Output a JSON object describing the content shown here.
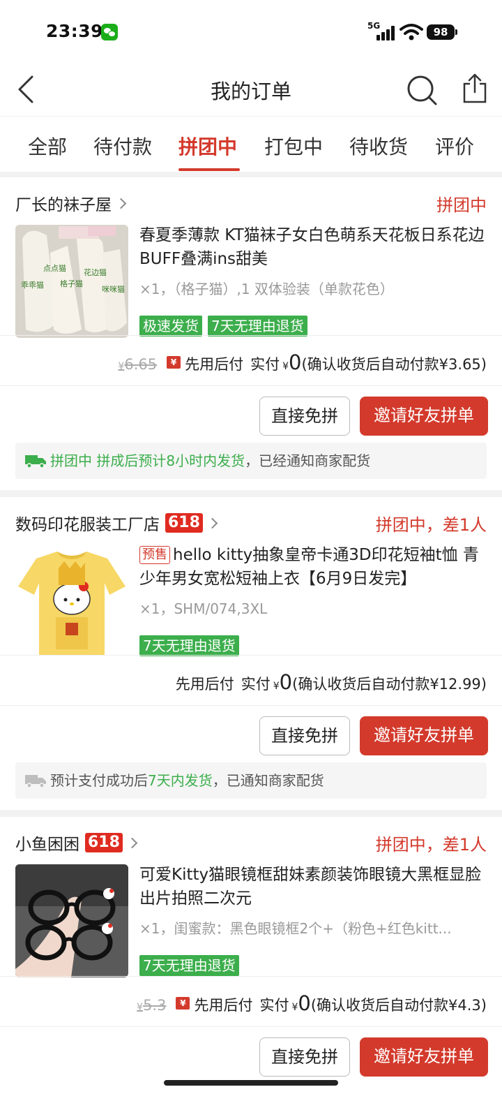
{
  "status_bar": {
    "time": "23:39",
    "network": "5G",
    "battery": "98",
    "icons": [
      "wechat-icon",
      "signal-icon",
      "wifi-icon",
      "battery-icon"
    ]
  },
  "header": {
    "title": "我的订单",
    "icons": [
      "back-icon",
      "search-icon",
      "share-icon"
    ]
  },
  "tabs": [
    {
      "label": "全部",
      "active": false
    },
    {
      "label": "待付款",
      "active": false
    },
    {
      "label": "拼团中",
      "active": true
    },
    {
      "label": "打包中",
      "active": false
    },
    {
      "label": "待收货",
      "active": false
    },
    {
      "label": "评价",
      "active": false
    }
  ],
  "orders": [
    {
      "shop": "厂长的袜子屋",
      "badge": "",
      "status": "拼团中",
      "title": "春夏季薄款 KT猫袜子女白色萌系天花板日系花边BUFF叠满ins甜美",
      "presale": "",
      "spec": "×1，（格子猫）,1 双体验装（单款花色）",
      "tags": [
        "极速发货",
        "7天无理由退货"
      ],
      "original_price": "6.65",
      "pay_label": "先用后付",
      "actual_label": "实付",
      "actual_amount": "0",
      "auto_pay_note": "(确认收货后自动付款¥3.65)",
      "buttons": [
        "直接免拼",
        "邀请好友拼单"
      ],
      "notice_green": "拼团中 拼成后预计8小时内发货",
      "notice_rest": "，已经通知商家配货"
    },
    {
      "shop": "数码印花服装工厂店",
      "badge": "618",
      "status": "拼团中，差1人",
      "title": "hello kitty抽象皇帝卡通3D印花短袖t恤 青少年男女宽松短袖上衣【6月9日发完】",
      "presale": "预售",
      "spec": "×1，SHM/074,3XL",
      "tags": [
        "7天无理由退货"
      ],
      "original_price": "",
      "pay_label": "先用后付",
      "actual_label": "实付",
      "actual_amount": "0",
      "auto_pay_note": "(确认收货后自动付款¥12.99)",
      "buttons": [
        "直接免拼",
        "邀请好友拼单"
      ],
      "notice_pre": "预计支付成功后",
      "notice_green": "7天内发货",
      "notice_rest": "，已通知商家配货"
    },
    {
      "shop": "小鱼困困",
      "badge": "618",
      "status": "拼团中，差1人",
      "title": "可爱Kitty猫眼镜框甜妹素颜装饰眼镜大黑框显脸出片拍照二次元",
      "presale": "",
      "spec": "×1，闺蜜款：黑色眼镜框2个+（粉色+红色kitt...",
      "tags": [
        "7天无理由退货"
      ],
      "original_price": "5.3",
      "pay_label": "先用后付",
      "actual_label": "实付",
      "actual_amount": "0",
      "auto_pay_note": "(确认收货后自动付款¥4.3)",
      "buttons": [
        "直接免拼",
        "邀请好友拼单"
      ]
    }
  ],
  "currency": "¥",
  "thumb_labels": [
    "点点猫",
    "花边猫",
    "格子猫",
    "乖乖猫",
    "咪咪猫"
  ],
  "colors": {
    "accent": "#d33a2c",
    "green": "#3cae4c",
    "badge": "#e02b20"
  }
}
